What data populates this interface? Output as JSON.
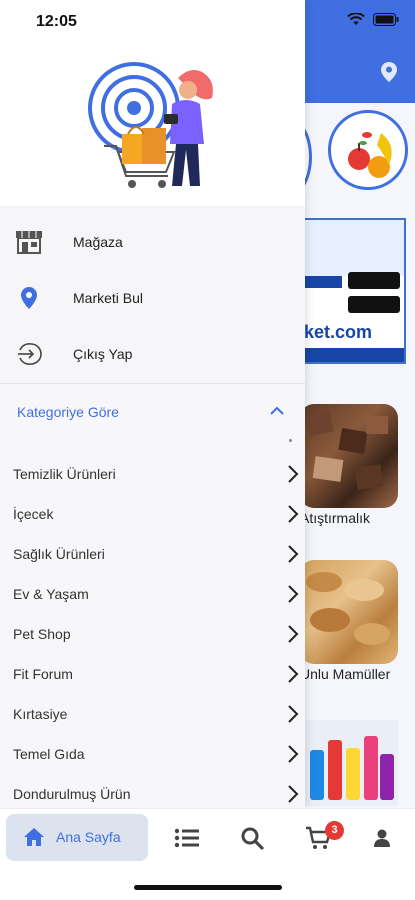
{
  "status_bar": {
    "time": "12:05"
  },
  "drawer": {
    "menu": [
      {
        "label": "Mağaza",
        "icon": "store-icon"
      },
      {
        "label": "Marketi Bul",
        "icon": "location-pin-icon"
      },
      {
        "label": "Çıkış Yap",
        "icon": "logout-icon"
      }
    ],
    "category_section": {
      "title": "Kategoriye Göre",
      "items": [
        "Temizlik Ürünleri",
        "İçecek",
        "Sağlık Ürünleri",
        "Ev & Yaşam",
        "Pet Shop",
        "Fit Forum",
        "Kırtasiye",
        "Temel Gıda",
        "Dondurulmuş Ürün"
      ]
    }
  },
  "background": {
    "banner_url": "ket.com",
    "tiles": [
      {
        "caption": "Atıştırmalık"
      },
      {
        "caption": "Unlu Mamüller"
      }
    ]
  },
  "bottom_nav": {
    "home_label": "Ana Sayfa",
    "cart_count": "3"
  },
  "colors": {
    "accent": "#3f6fe0",
    "badge": "#e53935"
  }
}
